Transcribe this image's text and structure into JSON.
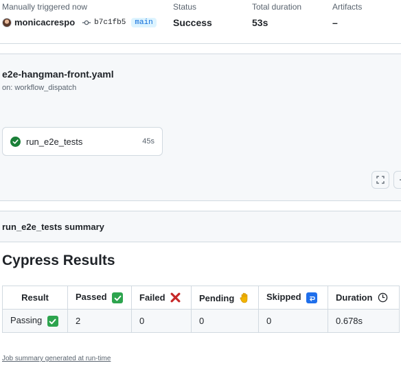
{
  "run": {
    "trigger_label": "Manually triggered now",
    "actor": "monicacrespo",
    "commit_sha": "b7c1fb5",
    "branch": "main",
    "status_label": "Status",
    "status_value": "Success",
    "duration_label": "Total duration",
    "duration_value": "53s",
    "artifacts_label": "Artifacts",
    "artifacts_value": "–"
  },
  "workflow": {
    "file": "e2e-hangman-front.yaml",
    "trigger": "on: workflow_dispatch",
    "job": {
      "name": "run_e2e_tests",
      "duration": "45s",
      "status": "success"
    }
  },
  "job_summary": {
    "header": "run_e2e_tests summary",
    "report_title": "Cypress Results",
    "columns": [
      "Result",
      "Passed",
      "Failed",
      "Pending",
      "Skipped",
      "Duration"
    ],
    "row": {
      "result": "Passing",
      "passed": "2",
      "failed": "0",
      "pending": "0",
      "skipped": "0",
      "duration": "0.678s"
    },
    "footer": "Job summary generated at run-time"
  },
  "colors": {
    "success": "#1a7f37",
    "emoji_check": "#2da44e",
    "emoji_cross": "#c62828",
    "emoji_skip": "#1f6feb",
    "link_blue": "#0969da"
  }
}
